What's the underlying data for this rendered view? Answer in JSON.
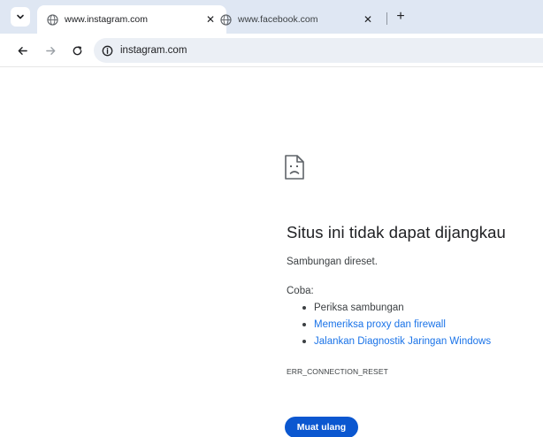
{
  "tabs": [
    {
      "title": "www.instagram.com",
      "active": true,
      "icon": "globe-icon"
    },
    {
      "title": "www.facebook.com",
      "active": false,
      "icon": "globe-icon"
    }
  ],
  "toolbar": {
    "url": "instagram.com"
  },
  "error": {
    "heading": "Situs ini tidak dapat dijangkau",
    "description": "Sambungan direset.",
    "try_label": "Coba:",
    "suggestions": [
      "Periksa sambungan",
      "Memeriksa proxy dan firewall",
      "Jalankan Diagnostik Jaringan Windows"
    ],
    "code": "ERR_CONNECTION_RESET",
    "reload_label": "Muat ulang"
  },
  "colors": {
    "accent": "#0b57d0",
    "link": "#1a73e8",
    "tabstrip": "#dfe7f3"
  }
}
